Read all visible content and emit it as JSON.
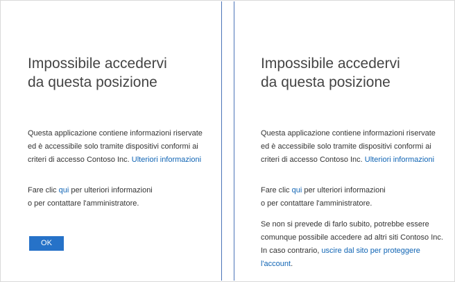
{
  "left_panel": {
    "title_line1": "Impossibile accedervi",
    "title_line2": "da questa posizione",
    "para1_line1": "Questa applicazione contiene informazioni riservate",
    "para1_line2": "ed è accessibile solo tramite dispositivi conformi ai",
    "para1_line3": "criteri di accesso Contoso Inc.",
    "para1_link": "Ulteriori informazioni",
    "para2_pre": "Fare clic",
    "para2_link": "qui",
    "para2_post": "per ulteriori informazioni",
    "para2_line2": "o per contattare l'amministratore.",
    "ok_label": "OK"
  },
  "right_panel": {
    "title_line1": "Impossibile accedervi",
    "title_line2": "da questa posizione",
    "para1_line1": "Questa applicazione contiene informazioni riservate",
    "para1_line2": "ed è accessibile solo tramite dispositivi conformi ai",
    "para1_line3": "criteri di accesso Contoso Inc.",
    "para1_link": "Ulteriori informazioni",
    "para2_pre": "Fare clic",
    "para2_link": "qui",
    "para2_post": "per ulteriori informazioni",
    "para2_line2": "o per contattare l'amministratore.",
    "para3_line1": "Se non si prevede di farlo subito, potrebbe essere",
    "para3_line2": "comunque possibile accedere ad altri siti Contoso Inc.",
    "para3_line3_pre": "In caso contrario,",
    "para3_link": "uscire dal sito per proteggere l'account",
    "para3_line3_post": "."
  },
  "colors": {
    "link": "#0f64b4",
    "button": "#2672c8",
    "divider": "#4a73b8"
  }
}
